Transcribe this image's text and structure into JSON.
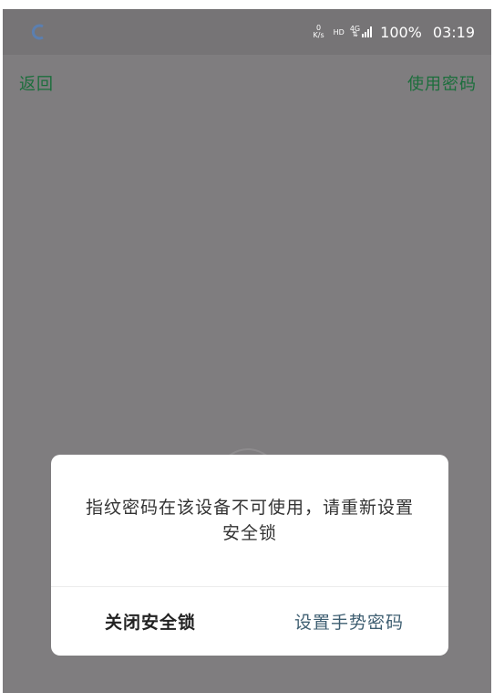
{
  "status_bar": {
    "net_speed_value": "0",
    "net_speed_unit": "K/s",
    "hd": "HD",
    "network": "4G",
    "battery": "100%",
    "time": "03:19"
  },
  "nav": {
    "back": "返回",
    "use_password": "使用密码"
  },
  "dialog": {
    "message": "指纹密码在该设备不可使用，请重新设置安全锁",
    "close_lock": "关闭安全锁",
    "set_gesture": "设置手势密码"
  },
  "colors": {
    "overlay": "#7f7d7f",
    "nav_text": "#1c6e3c",
    "secondary_button": "#3f5f72"
  }
}
